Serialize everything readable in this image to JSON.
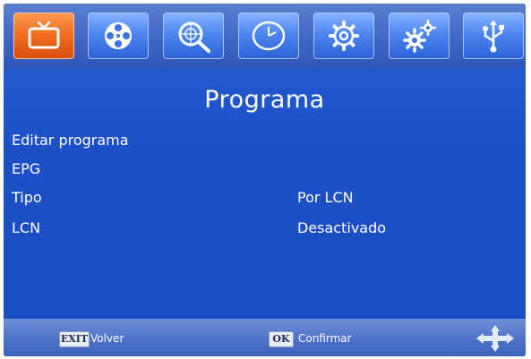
{
  "colors": {
    "background": "#1f55c8",
    "tab_active": "#f06a1e",
    "tab_inactive": "#4d86f0",
    "text": "#ffffff"
  },
  "tabs": [
    {
      "icon": "tv-icon",
      "active": true
    },
    {
      "icon": "film-reel-icon",
      "active": false
    },
    {
      "icon": "channel-search-icon",
      "active": false
    },
    {
      "icon": "clock-icon",
      "active": false
    },
    {
      "icon": "settings-gear-icon",
      "active": false
    },
    {
      "icon": "advanced-settings-gears-icon",
      "active": false
    },
    {
      "icon": "usb-icon",
      "active": false
    }
  ],
  "main": {
    "title": "Programa",
    "items": [
      {
        "label": "Editar programa",
        "value": ""
      },
      {
        "label": "EPG",
        "value": ""
      },
      {
        "label": "Tipo",
        "value": "Por LCN"
      },
      {
        "label": "LCN",
        "value": "Desactivado"
      }
    ]
  },
  "footer": {
    "exit_key": "EXIT",
    "exit_label": "Volver",
    "ok_key": "OK",
    "ok_label": "Confirmar",
    "nav_icon": "directional-arrows-icon"
  }
}
